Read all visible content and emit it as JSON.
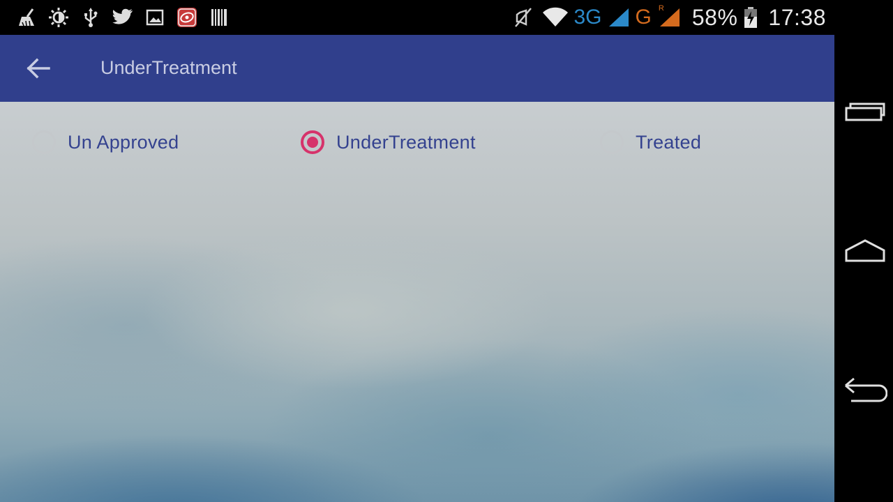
{
  "status_bar": {
    "left_icons": [
      "cleaner-icon",
      "brightness-icon",
      "usb-icon",
      "twitter-icon",
      "image-icon",
      "app-notification-icon",
      "barcode-icon"
    ],
    "right_icons": [
      "muted-icon",
      "wifi-icon",
      "signal-icon",
      "roaming-signal-icon",
      "battery-charging-icon"
    ],
    "network_3g": "3G",
    "network_g": "G",
    "roaming_r": "R",
    "battery": "58%",
    "time": "17:38",
    "colors": {
      "network_3g": "#2b89c9",
      "network_g": "#d46b1e"
    }
  },
  "app_bar": {
    "back_icon": "arrow-left-icon",
    "title": "UnderTreatment",
    "color": "#303f8c"
  },
  "filters": {
    "options": [
      {
        "label": "Un Approved",
        "checked": false
      },
      {
        "label": "UnderTreatment",
        "checked": true
      },
      {
        "label": "Treated",
        "checked": false
      }
    ],
    "accent": "#d6336b"
  },
  "nav_bar": {
    "buttons": [
      "recent-apps-icon",
      "home-icon",
      "back-icon"
    ]
  }
}
